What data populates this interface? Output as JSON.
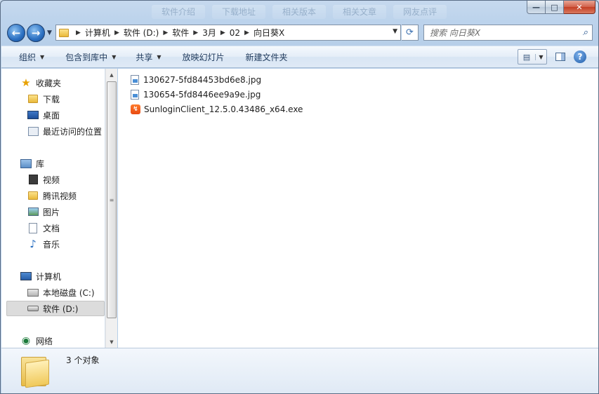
{
  "window": {
    "ghost_tabs": [
      "软件介绍",
      "下载地址",
      "相关版本",
      "相关文章",
      "网友点评"
    ],
    "caption": {
      "minimize": "—",
      "maximize": "□",
      "close": "✕"
    }
  },
  "nav_buttons": {
    "back_icon": "arrow-left-icon",
    "forward_icon": "arrow-right-icon"
  },
  "address": {
    "crumbs": [
      "计算机",
      "软件 (D:)",
      "软件",
      "3月",
      "02",
      "向日葵X"
    ]
  },
  "search": {
    "placeholder": "搜索 向日葵X"
  },
  "toolbar": {
    "organize": "组织",
    "include_library": "包含到库中",
    "share": "共享",
    "slideshow": "放映幻灯片",
    "new_folder": "新建文件夹"
  },
  "nav_pane": {
    "favorites": "收藏夹",
    "downloads": "下载",
    "desktop": "桌面",
    "recent": "最近访问的位置",
    "libraries": "库",
    "videos": "视频",
    "tencent_video": "腾讯视频",
    "pictures": "图片",
    "documents": "文档",
    "music": "音乐",
    "computer": "计算机",
    "drive_c": "本地磁盘 (C:)",
    "drive_d": "软件 (D:)",
    "network": "网络"
  },
  "files": [
    {
      "name": "130627-5fd84453bd6e8.jpg",
      "type": "jpg"
    },
    {
      "name": "130654-5fd8446ee9a9e.jpg",
      "type": "jpg"
    },
    {
      "name": "SunloginClient_12.5.0.43486_x64.exe",
      "type": "exe"
    }
  ],
  "details": {
    "count": "3 个对象"
  }
}
